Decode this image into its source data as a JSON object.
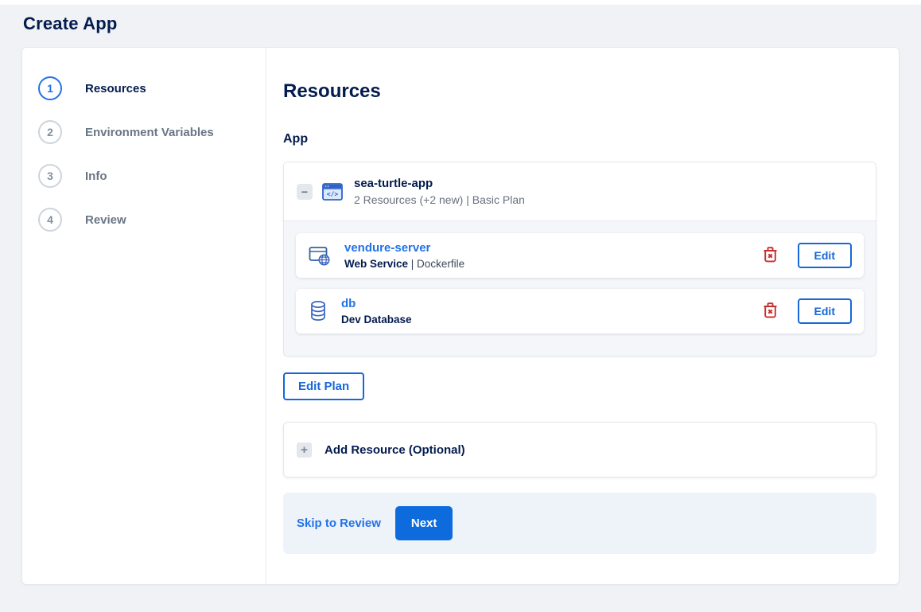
{
  "page": {
    "title": "Create App"
  },
  "colors": {
    "accent_blue": "#0d6bdd",
    "link_blue": "#2371e8",
    "heading_navy": "#031b4e",
    "danger_red": "#c62f2f",
    "footer_band": "#eef3fa"
  },
  "stepper": {
    "steps": [
      {
        "number": "1",
        "label": "Resources",
        "active": true
      },
      {
        "number": "2",
        "label": "Environment Variables",
        "active": false
      },
      {
        "number": "3",
        "label": "Info",
        "active": false
      },
      {
        "number": "4",
        "label": "Review",
        "active": false
      }
    ]
  },
  "main": {
    "heading": "Resources",
    "section_label": "App",
    "app_card": {
      "icon": "code-window-icon",
      "collapse_icon": "minus-icon",
      "collapse_glyph": "−",
      "name": "sea-turtle-app",
      "summary": "2 Resources (+2 new) | Basic Plan",
      "resources": [
        {
          "icon": "web-service-globe-icon",
          "name": "vendure-server",
          "type": "Web Service",
          "detail": " | Dockerfile",
          "delete_icon": "trash-icon",
          "edit_label": "Edit"
        },
        {
          "icon": "database-icon",
          "name": "db",
          "type": "Dev Database",
          "detail": "",
          "delete_icon": "trash-icon",
          "edit_label": "Edit"
        }
      ]
    },
    "edit_plan_label": "Edit Plan",
    "add_resource": {
      "icon": "plus-icon",
      "plus_glyph": "+",
      "label": "Add Resource (Optional)"
    },
    "footer": {
      "skip_label": "Skip to Review",
      "next_label": "Next"
    }
  }
}
